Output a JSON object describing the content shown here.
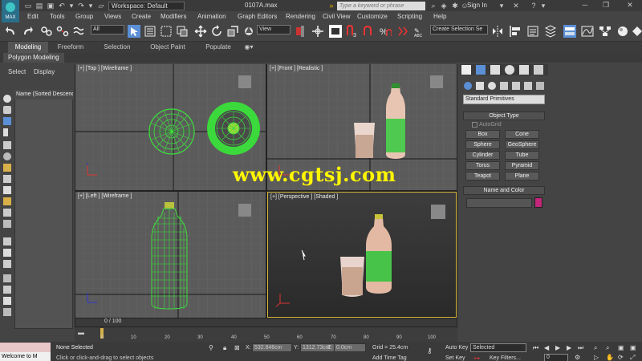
{
  "titlebar": {
    "workspace": "Workspace: Default",
    "filename": "0107A.max",
    "search_placeholder": "Type a keyword or phrase",
    "signin": "Sign In",
    "logo_text": "MAX"
  },
  "menu": [
    "Edit",
    "Tools",
    "Group",
    "Views",
    "Create",
    "Modifiers",
    "Animation",
    "Graph Editors",
    "Rendering",
    "Civil View",
    "Customize",
    "Scripting",
    "Help"
  ],
  "toolbar": {
    "filter_value": "All",
    "refcoord_value": "View",
    "selection_set_value": "Create Selection Se"
  },
  "ribbon": {
    "tabs": [
      "Modeling",
      "Freeform",
      "Selection",
      "Object Paint",
      "Populate"
    ],
    "active_tab": "Modeling",
    "sub_label": "Polygon Modeling"
  },
  "scene_explorer": {
    "tabs": [
      "Select",
      "Display"
    ],
    "column_header": "Name (Sorted Descending)"
  },
  "viewports": {
    "top": "[+] [Top ] [Wireframe ]",
    "front": "[+] [Front ] [Realistic ]",
    "left": "[+] [Left ] [Wireframe ]",
    "perspective": "[+] [Perspective ] [Shaded ]"
  },
  "command_panel": {
    "primitives": "Standard Primitives",
    "object_type_header": "Object Type",
    "autogrid": "AutoGrid",
    "buttons": [
      "Box",
      "Cone",
      "Sphere",
      "GeoSphere",
      "Cylinder",
      "Tube",
      "Torus",
      "Pyramid",
      "Teapot",
      "Plane"
    ],
    "name_color_header": "Name and Color",
    "swatch_color": "#c3267b"
  },
  "timeline": {
    "position": "0 / 100",
    "ticks": [
      "0",
      "10",
      "20",
      "30",
      "40",
      "50",
      "60",
      "70",
      "80",
      "90",
      "100"
    ]
  },
  "status": {
    "maxscript": "Welcome to M",
    "none_selected": "None Selected",
    "hint": "Click or click-and-drag to select objects",
    "x_label": "X:",
    "x_value": "532.846cm",
    "y_label": "Y:",
    "y_value": "1312.73cm",
    "z_label": "Z:",
    "z_value": "0.0cm",
    "grid": "Grid = 25.4cm",
    "add_time_tag": "Add Time Tag",
    "auto_key": "Auto Key",
    "set_key": "Set Key",
    "selected": "Selected",
    "key_filters": "Key Filters...",
    "frame": "0"
  },
  "watermark": "www.cgtsj.com"
}
